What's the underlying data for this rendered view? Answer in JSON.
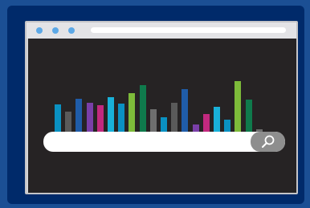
{
  "window": {
    "controls": [
      {
        "name": "window-dot-1",
        "color": "#5ca8e6"
      },
      {
        "name": "window-dot-2",
        "color": "#5ca8e6"
      },
      {
        "name": "window-dot-3",
        "color": "#5ca8e6"
      }
    ],
    "address_bar_color": "#ffffff"
  },
  "colors": {
    "page_background": "#1b4f94",
    "frame": "#002a6a",
    "content_background": "#262324",
    "search_button": "#8e8e8e"
  },
  "bar_pattern": {
    "colors": [
      "#0a91c2",
      "#5a5a5a",
      "#1f5ca8",
      "#7a3fa8",
      "#c2297f",
      "#19b1d9",
      "#0a91c2",
      "#7dbb3a",
      "#0f7a4c",
      "#6e6e6e",
      "#0a91c2",
      "#5a5a5a",
      "#1f5ca8",
      "#7a3fa8",
      "#c2297f",
      "#19b1d9",
      "#0a91c2",
      "#7dbb3a",
      "#0f7a4c",
      "#6e6e6e"
    ],
    "heights": [
      0.62,
      0.52,
      0.69,
      0.64,
      0.61,
      0.71,
      0.63,
      0.77,
      0.87,
      0.55,
      0.45,
      0.64,
      0.82,
      0.35,
      0.49,
      0.59,
      0.41,
      0.93,
      0.68,
      0.29
    ]
  },
  "search": {
    "value": "",
    "button_icon": "search-icon"
  }
}
